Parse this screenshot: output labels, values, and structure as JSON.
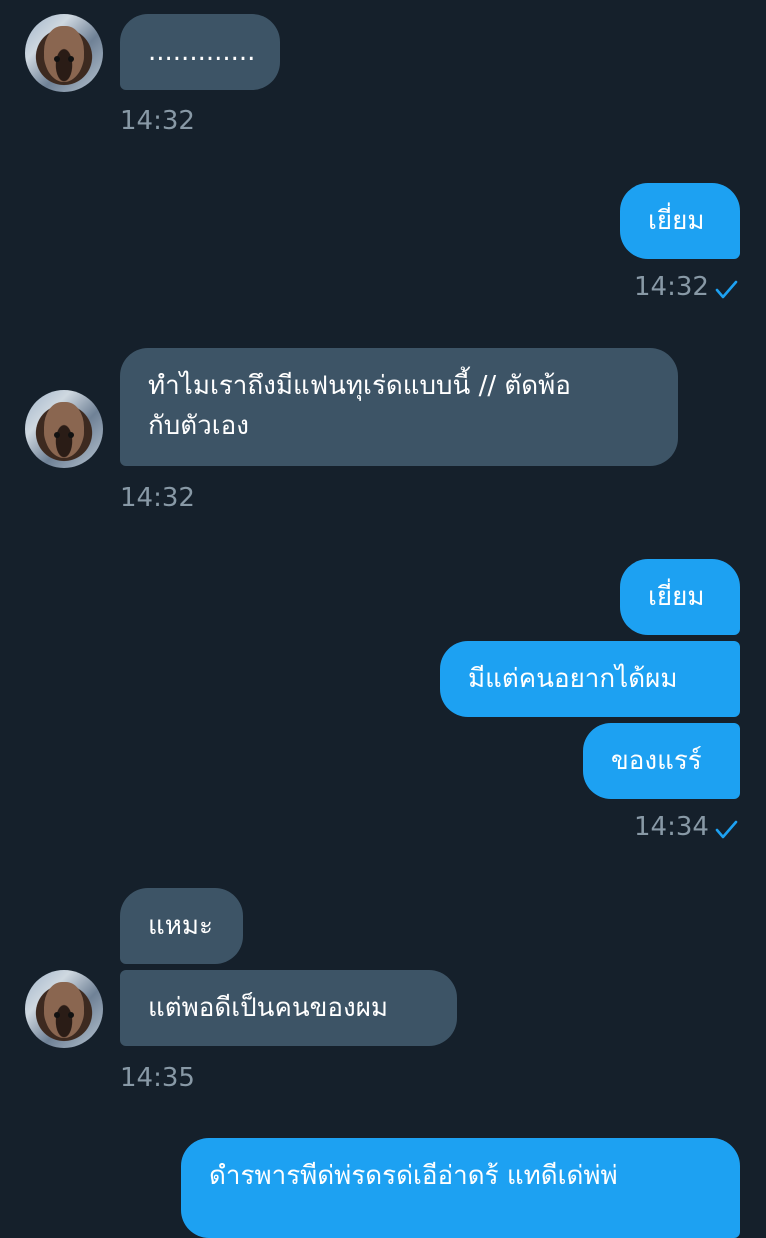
{
  "messages": {
    "m1": {
      "text": "............."
    },
    "t1": "14:32",
    "m2": {
      "text": "เยี่ยม"
    },
    "t2": "14:32",
    "m3": {
      "line1": "ทำไมเราถึงมีแฟนทุเร่ดแบบนี้ // ตัดพ้อ",
      "line2": "กับตัวเอง"
    },
    "t3": "14:32",
    "m4": {
      "text": "เยี่ยม"
    },
    "m5": {
      "text": "มีแต่คนอยากได้ผม"
    },
    "m6": {
      "text": "ของแรร์"
    },
    "t4": "14:34",
    "m7": {
      "text": "แหมะ"
    },
    "m8": {
      "text": "แต่พอดีเป็นคนของผม"
    },
    "t5": "14:35",
    "m9": {
      "text": "ดำรพารพีด่พ่รดรด่เอีอ่าดร้ แทดีเด่พ่พ่"
    }
  },
  "colors": {
    "background": "#15202b",
    "incoming_bubble": "#3d5466",
    "outgoing_bubble": "#1da1f2",
    "timestamp": "#8899a6",
    "read_check": "#1da1f2"
  },
  "icons": {
    "avatar": "cat-avatar",
    "read_receipt": "checkmark-icon"
  }
}
